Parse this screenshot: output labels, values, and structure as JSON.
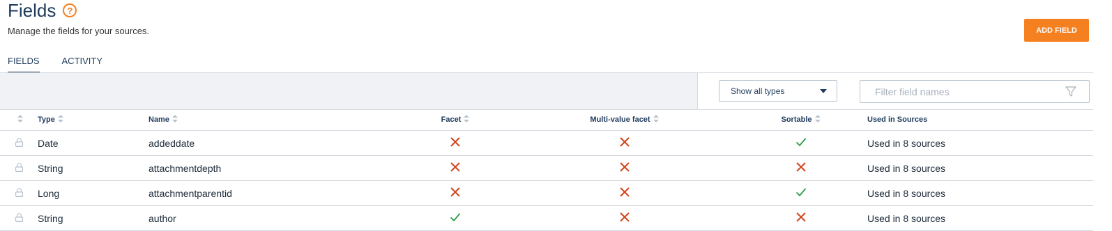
{
  "page": {
    "title": "Fields",
    "subtitle": "Manage the fields for your sources.",
    "add_button": "ADD FIELD"
  },
  "tabs": [
    {
      "label": "FIELDS",
      "active": true
    },
    {
      "label": "ACTIVITY",
      "active": false
    }
  ],
  "toolbar": {
    "type_select_value": "Show all types",
    "filter_placeholder": "Filter field names"
  },
  "table": {
    "columns": [
      "",
      "Type",
      "Name",
      "Facet",
      "Multi-value facet",
      "Sortable",
      "Used in Sources"
    ],
    "rows": [
      {
        "type": "Date",
        "name": "addeddate",
        "facet": false,
        "multi": false,
        "sortable": true,
        "used": "Used in 8 sources"
      },
      {
        "type": "String",
        "name": "attachmentdepth",
        "facet": false,
        "multi": false,
        "sortable": false,
        "used": "Used in 8 sources"
      },
      {
        "type": "Long",
        "name": "attachmentparentid",
        "facet": false,
        "multi": false,
        "sortable": true,
        "used": "Used in 8 sources"
      },
      {
        "type": "String",
        "name": "author",
        "facet": true,
        "multi": false,
        "sortable": false,
        "used": "Used in 8 sources"
      }
    ]
  },
  "colors": {
    "accent": "#f58020",
    "navy": "#1e3a5c",
    "check": "#2e9d4a",
    "cross": "#d2431b"
  }
}
